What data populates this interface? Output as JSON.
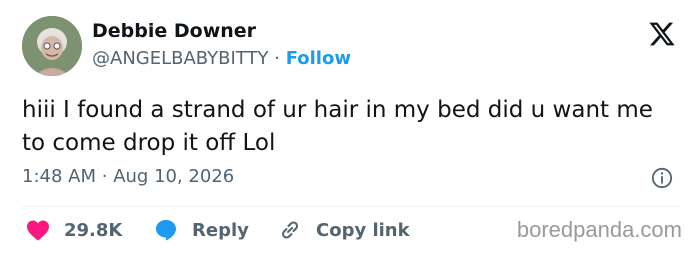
{
  "author": {
    "display_name": "Debbie Downer",
    "handle": "@ANGELBABYBITTY",
    "separator": "·",
    "follow_label": "Follow",
    "avatar_icon": "profile-photo"
  },
  "brand": {
    "icon": "x-logo-icon"
  },
  "tweet": {
    "text": "hiii I found a strand of ur hair in my bed did u want me to come drop it off Lol",
    "time": "1:48 AM",
    "separator": "·",
    "date": "Aug 10, 2026",
    "info_icon": "info-icon"
  },
  "actions": {
    "like_count": "29.8K",
    "reply_label": "Reply",
    "copy_label": "Copy link"
  },
  "watermark": "boredpanda.com",
  "colors": {
    "accent": "#1d9bf0",
    "like": "#f91880",
    "text": "#0f1419",
    "secondary": "#536471"
  }
}
